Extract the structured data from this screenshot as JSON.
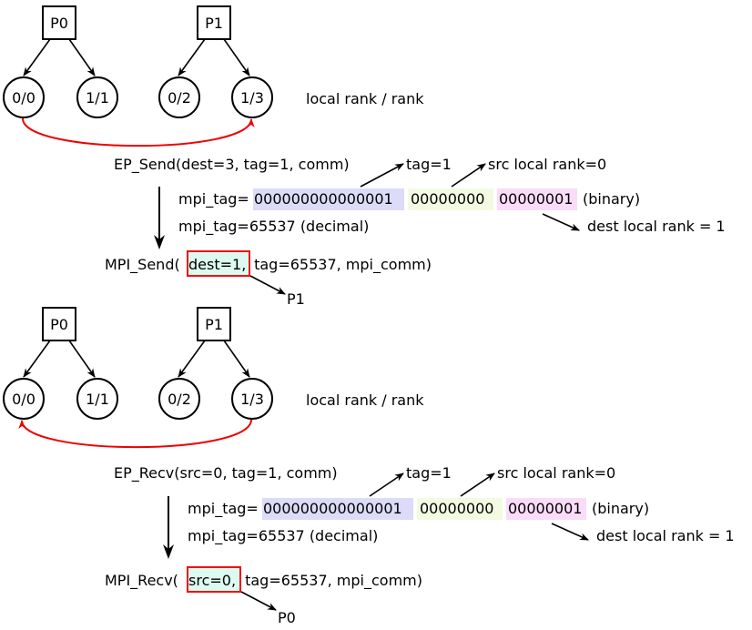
{
  "colors": {
    "arrow": "#000000",
    "link_arrow": "#ee0000",
    "tag_bits": "#dcdcf8",
    "src_bits": "#f2fbe2",
    "dest_bits": "#fadcf8",
    "highlight_fill": "#dcfaf0",
    "highlight_border": "#ee1111"
  },
  "send": {
    "processes": [
      {
        "label": "P0",
        "ranks": [
          "0/0",
          "1/1"
        ]
      },
      {
        "label": "P1",
        "ranks": [
          "0/2",
          "1/3"
        ]
      }
    ],
    "legend": "local rank / rank",
    "ep_call": "EP_Send(dest=3, tag=1, comm)",
    "tag_note": "tag=1",
    "src_note": "src local rank=0",
    "mpi_tag_prefix": "mpi_tag=",
    "tag_bits": "000000000000001",
    "src_bits": "00000000",
    "dest_bits": "00000001",
    "binary_suffix": "(binary)",
    "decimal_line": "mpi_tag=65537 (decimal)",
    "dest_note": "dest local rank = 1",
    "mpi_call_prefix": "MPI_Send(",
    "mpi_call_highlight": "dest=1,",
    "mpi_call_suffix": " tag=65537, mpi_comm)",
    "target_note": "P1"
  },
  "recv": {
    "processes": [
      {
        "label": "P0",
        "ranks": [
          "0/0",
          "1/1"
        ]
      },
      {
        "label": "P1",
        "ranks": [
          "0/2",
          "1/3"
        ]
      }
    ],
    "legend": "local rank / rank",
    "ep_call": "EP_Recv(src=0, tag=1, comm)",
    "tag_note": "tag=1",
    "src_note": "src local rank=0",
    "mpi_tag_prefix": "mpi_tag=",
    "tag_bits": "000000000000001",
    "src_bits": "00000000",
    "dest_bits": "00000001",
    "binary_suffix": "(binary)",
    "decimal_line": "mpi_tag=65537 (decimal)",
    "dest_note": "dest local rank = 1",
    "mpi_call_prefix": "MPI_Recv(",
    "mpi_call_highlight": "src=0,",
    "mpi_call_suffix": " tag=65537, mpi_comm)",
    "target_note": "P0"
  }
}
